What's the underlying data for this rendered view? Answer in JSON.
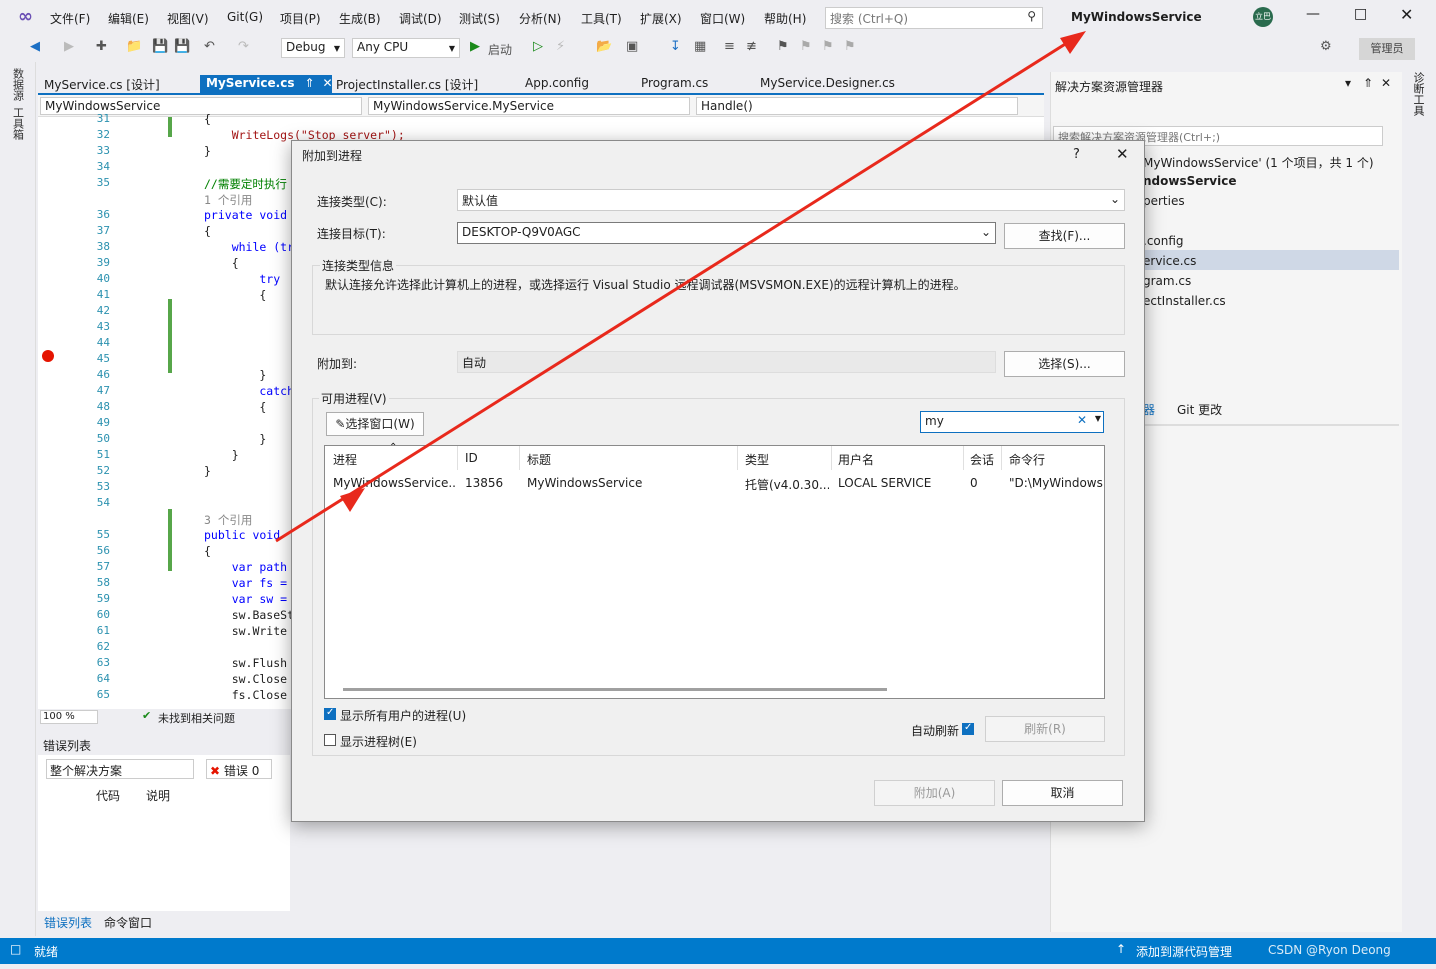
{
  "menubar": {
    "items": [
      "文件(F)",
      "编辑(E)",
      "视图(V)",
      "Git(G)",
      "项目(P)",
      "生成(B)",
      "调试(D)",
      "测试(S)",
      "分析(N)",
      "工具(T)",
      "扩展(X)",
      "窗口(W)",
      "帮助(H)"
    ],
    "search_placeholder": "搜索 (Ctrl+Q)",
    "window_title": "MyWindowsService",
    "avatar_initials": "立巴",
    "admin_label": "管理员"
  },
  "toolbar": {
    "config": "Debug",
    "platform": "Any CPU",
    "start_label": "启动"
  },
  "left_strip": {
    "items": [
      "数据源",
      "工具箱"
    ]
  },
  "right_strip": {
    "items": [
      "诊断工具"
    ]
  },
  "tabs": [
    "MyService.cs [设计]",
    "MyService.cs",
    "ProjectInstaller.cs [设计]",
    "App.config",
    "Program.cs",
    "MyService.Designer.cs"
  ],
  "navbar": {
    "project": "MyWindowsService",
    "class": "MyWindowsService.MyService",
    "member": "Handle()"
  },
  "editor": {
    "lines": [
      {
        "n": "31",
        "t": "{"
      },
      {
        "n": "32",
        "t": "    WriteLogs(\"Stop server\");"
      },
      {
        "n": "33",
        "t": "}"
      },
      {
        "n": "34",
        "t": ""
      },
      {
        "n": "35",
        "t": "//需要定时执行"
      },
      {
        "n": "",
        "t": "1 个引用"
      },
      {
        "n": "36",
        "t": "private void"
      },
      {
        "n": "37",
        "t": "{"
      },
      {
        "n": "38",
        "t": "    while (tr"
      },
      {
        "n": "39",
        "t": "    {"
      },
      {
        "n": "40",
        "t": "        try"
      },
      {
        "n": "41",
        "t": "        {"
      },
      {
        "n": "42",
        "t": ""
      },
      {
        "n": "43",
        "t": ""
      },
      {
        "n": "44",
        "t": ""
      },
      {
        "n": "45",
        "t": ""
      },
      {
        "n": "46",
        "t": "        }"
      },
      {
        "n": "47",
        "t": "        catch"
      },
      {
        "n": "48",
        "t": "        {"
      },
      {
        "n": "49",
        "t": ""
      },
      {
        "n": "50",
        "t": "        }"
      },
      {
        "n": "51",
        "t": "    }"
      },
      {
        "n": "52",
        "t": "}"
      },
      {
        "n": "53",
        "t": ""
      },
      {
        "n": "54",
        "t": ""
      },
      {
        "n": "",
        "t": "3 个引用"
      },
      {
        "n": "55",
        "t": "public void"
      },
      {
        "n": "56",
        "t": "{"
      },
      {
        "n": "57",
        "t": "    var path"
      },
      {
        "n": "58",
        "t": "    var fs ="
      },
      {
        "n": "59",
        "t": "    var sw ="
      },
      {
        "n": "60",
        "t": "    sw.BaseSt"
      },
      {
        "n": "61",
        "t": "    sw.Write"
      },
      {
        "n": "62",
        "t": ""
      },
      {
        "n": "63",
        "t": "    sw.Flush"
      },
      {
        "n": "64",
        "t": "    sw.Close"
      },
      {
        "n": "65",
        "t": "    fs.Close"
      }
    ],
    "zoom": "100 %",
    "issues": "未找到相关问题"
  },
  "error_list": {
    "title": "错误列表",
    "scope": "整个解决方案",
    "errors": "错误 0",
    "col_code": "代码",
    "col_desc": "说明",
    "tab_errors": "错误列表",
    "tab_command": "命令窗口"
  },
  "solution": {
    "title": "解决方案资源管理器",
    "search": "搜索解决方案资源管理器(Ctrl+;)",
    "items": [
      "MyWindowsService' (1 个项目，共 1 个)",
      "ndowsService",
      "perties",
      "",
      ".config",
      "ervice.cs",
      "gram.cs",
      "ectInstaller.cs"
    ],
    "tab_a": "器",
    "tab_b": "Git 更改"
  },
  "statusbar": {
    "ready": "就绪",
    "add_source": "添加到源代码管理",
    "watermark": "CSDN @Ryon Deong"
  },
  "dialog": {
    "title": "附加到进程",
    "help": "?",
    "conn_type_label": "连接类型(C):",
    "conn_type_value": "默认值",
    "conn_target_label": "连接目标(T):",
    "conn_target_value": "DESKTOP-Q9V0AGC",
    "find_btn": "查找(F)...",
    "info_title": "连接类型信息",
    "info_text": "默认连接允许选择此计算机上的进程，或选择运行 Visual Studio 远程调试器(MSVSMON.EXE)的远程计算机上的进程。",
    "attach_to_label": "附加到:",
    "attach_to_value": "自动",
    "select_btn": "选择(S)...",
    "available_label": "可用进程(V)",
    "select_window_btn": "选择窗口(W)",
    "filter_value": "my",
    "columns": [
      "进程",
      "ID",
      "标题",
      "类型",
      "用户名",
      "会话",
      "命令行"
    ],
    "rows": [
      [
        "MyWindowsService....",
        "13856",
        "MyWindowsService",
        "托管(v4.0.30...",
        "LOCAL SERVICE",
        "0",
        "\"D:\\MyWindowsS"
      ]
    ],
    "show_all_users": "显示所有用户的进程(U)",
    "show_tree": "显示进程树(E)",
    "auto_refresh": "自动刷新",
    "refresh_btn": "刷新(R)",
    "attach_btn": "附加(A)",
    "cancel_btn": "取消"
  },
  "colors": {
    "accent": "#0e70c0",
    "statusbar": "#007acc",
    "arrow": "#e8291c"
  }
}
